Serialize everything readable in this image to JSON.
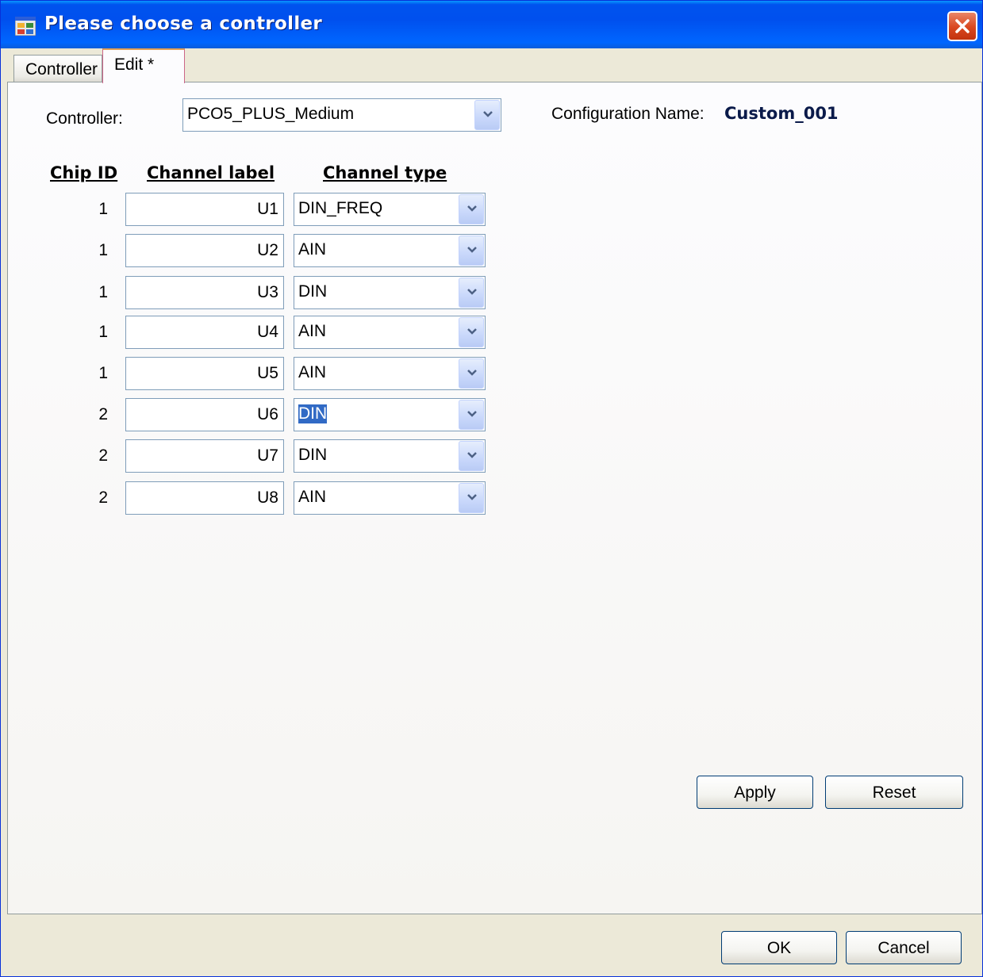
{
  "window": {
    "title": "Please choose a controller"
  },
  "tabs": [
    {
      "label": "Controller",
      "selected": false
    },
    {
      "label": "Edit *",
      "selected": true
    }
  ],
  "controller": {
    "label": "Controller:",
    "value": "PCO5_PLUS_Medium"
  },
  "configuration": {
    "label": "Configuration Name:",
    "value": "Custom_001"
  },
  "table": {
    "headers": {
      "chip_id": "Chip ID",
      "channel_label": "Channel label",
      "channel_type": "Channel type"
    },
    "rows": [
      {
        "chip_id": "1",
        "channel_label": "U1",
        "channel_type": "DIN_FREQ"
      },
      {
        "chip_id": "1",
        "channel_label": "U2",
        "channel_type": "AIN"
      },
      {
        "chip_id": "1",
        "channel_label": "U3",
        "channel_type": "DIN"
      },
      {
        "chip_id": "1",
        "channel_label": "U4",
        "channel_type": "AIN"
      },
      {
        "chip_id": "1",
        "channel_label": "U5",
        "channel_type": "AIN"
      },
      {
        "chip_id": "2",
        "channel_label": "U6",
        "channel_type": "DIN"
      },
      {
        "chip_id": "2",
        "channel_label": "U7",
        "channel_type": "DIN"
      },
      {
        "chip_id": "2",
        "channel_label": "U8",
        "channel_type": "AIN"
      }
    ]
  },
  "buttons": {
    "apply": "Apply",
    "reset": "Reset",
    "ok": "OK",
    "cancel": "Cancel"
  },
  "colors": {
    "titlebar": "#0054e3",
    "selection": "#316ac5",
    "window_background": "#ece9d8"
  },
  "icons": {
    "app": "app-icon",
    "close": "close-icon",
    "dropdown": "chevron-down-icon"
  }
}
